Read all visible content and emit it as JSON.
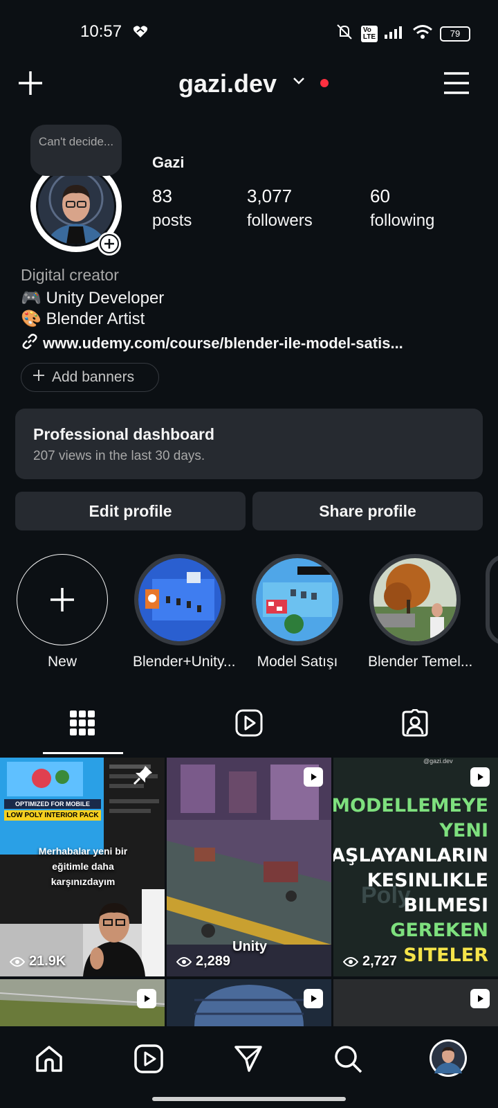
{
  "status": {
    "time": "10:57",
    "battery": "79"
  },
  "header": {
    "username": "gazi.dev"
  },
  "profile": {
    "tooltip": "Can't decide...",
    "display_name": "Gazi",
    "stats": [
      {
        "num": "83",
        "label": "posts"
      },
      {
        "num": "3,077",
        "label": "followers"
      },
      {
        "num": "60",
        "label": "following"
      }
    ],
    "category": "Digital creator",
    "bio": [
      "🎮 Unity Developer",
      "🎨 Blender Artist"
    ],
    "link": "www.udemy.com/course/blender-ile-model-satis...",
    "add_banners": "Add banners"
  },
  "dashboard": {
    "title": "Professional dashboard",
    "subtitle": "207 views in the last 30 days."
  },
  "actions": {
    "edit": "Edit profile",
    "share": "Share profile"
  },
  "highlights": [
    {
      "label": "New"
    },
    {
      "label": "Blender+Unity..."
    },
    {
      "label": "Model Satışı"
    },
    {
      "label": "Blender Temel..."
    }
  ],
  "posts": [
    {
      "views": "21.9K",
      "banner": "OPTIMIZED FOR MOBILE",
      "banner2": "LOW POLY INTERIOR PACK",
      "caption": "Merhabalar yeni bir eğitimle daha karşınızdayım"
    },
    {
      "views": "2,289",
      "caption": "Unity"
    },
    {
      "views": "2,727",
      "lines": [
        "MODELLEMEYE",
        "YENI",
        "BAŞLAYANLARIN",
        "KESINLIKLE",
        "BILMESI",
        "GEREKEN",
        "SITELER"
      ],
      "brand": "Poly",
      "handle": "@gazi.dev"
    }
  ]
}
